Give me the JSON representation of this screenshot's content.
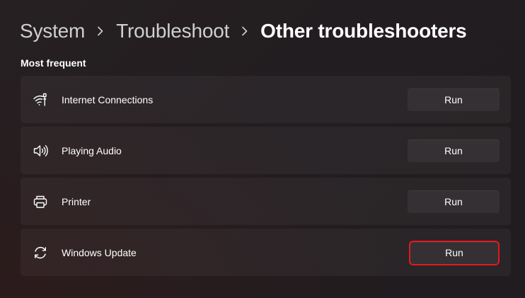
{
  "breadcrumb": {
    "items": [
      {
        "label": "System"
      },
      {
        "label": "Troubleshoot"
      },
      {
        "label": "Other troubleshooters"
      }
    ]
  },
  "section": {
    "title": "Most frequent"
  },
  "troubleshooters": [
    {
      "label": "Internet Connections",
      "icon": "wifi-network-icon",
      "button": "Run"
    },
    {
      "label": "Playing Audio",
      "icon": "speaker-icon",
      "button": "Run"
    },
    {
      "label": "Printer",
      "icon": "printer-icon",
      "button": "Run"
    },
    {
      "label": "Windows Update",
      "icon": "sync-icon",
      "button": "Run",
      "highlighted": true
    }
  ],
  "colors": {
    "highlight_outline": "#e21919",
    "button_bg": "#353034",
    "card_bg": "#2b2628"
  }
}
